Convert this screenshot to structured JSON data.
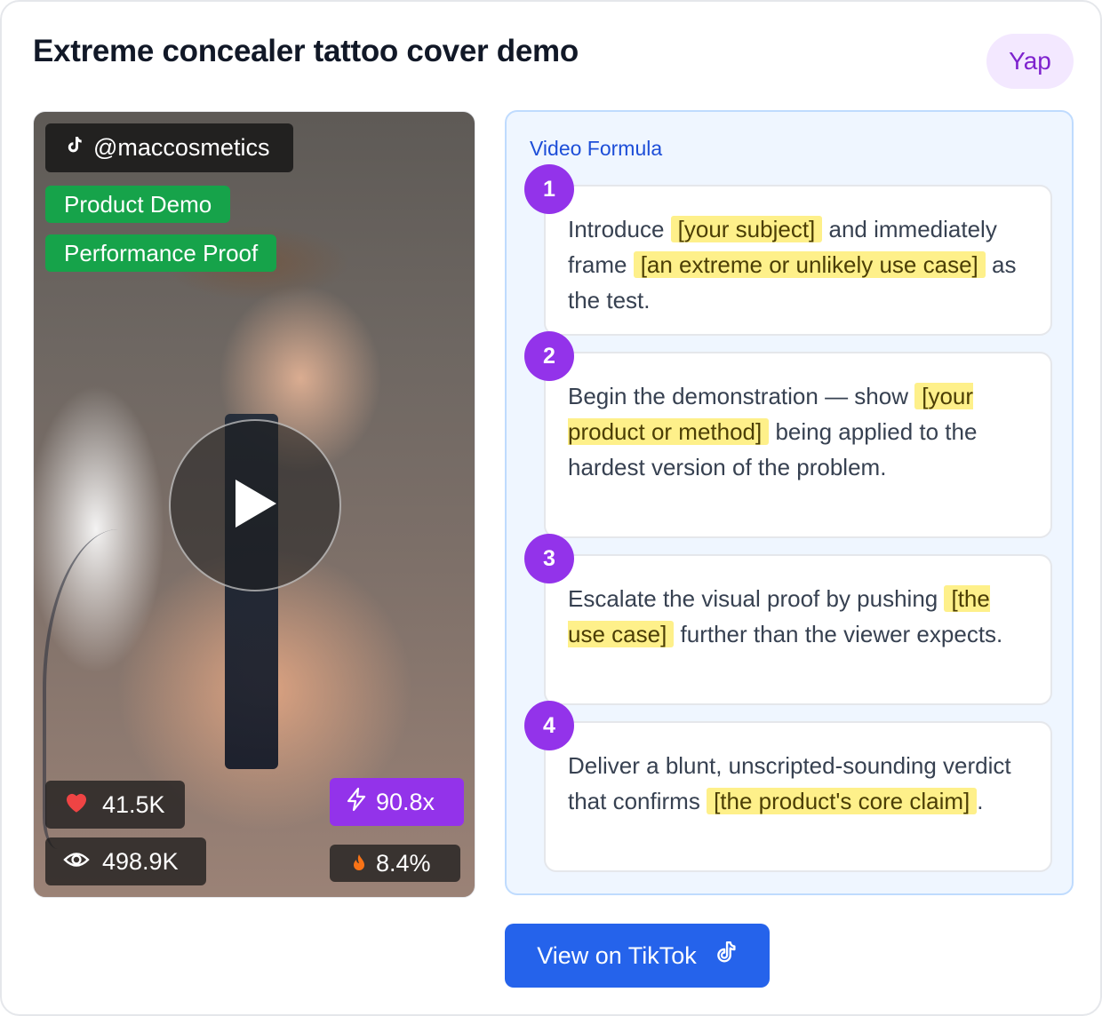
{
  "card": {
    "title": "Extreme concealer tattoo cover demo",
    "category_badge": "Yap"
  },
  "video": {
    "handle": "@maccosmetics",
    "tags": [
      "Product Demo",
      "Performance Proof"
    ],
    "likes": "41.5K",
    "views": "498.9K",
    "multiplier": "90.8x",
    "engagement": "8.4%",
    "icons": [
      "tiktok-icon",
      "play-icon",
      "heart-icon",
      "eye-icon",
      "bolt-icon",
      "flame-icon"
    ]
  },
  "formula": {
    "title": "Video Formula",
    "steps": [
      {
        "number": "1",
        "parts": [
          {
            "text": "Introduce ",
            "hl": false
          },
          {
            "text": "[your subject]",
            "hl": true
          },
          {
            "text": " and immediately frame ",
            "hl": false
          },
          {
            "text": "[an extreme or unlikely use case]",
            "hl": true
          },
          {
            "text": " as the test.",
            "hl": false
          }
        ]
      },
      {
        "number": "2",
        "parts": [
          {
            "text": "Begin the demonstration — show ",
            "hl": false
          },
          {
            "text": "[your product or method]",
            "hl": true
          },
          {
            "text": " being applied to the hardest version of the problem.",
            "hl": false
          }
        ]
      },
      {
        "number": "3",
        "parts": [
          {
            "text": "Escalate the visual proof by pushing ",
            "hl": false
          },
          {
            "text": "[the use case]",
            "hl": true
          },
          {
            "text": " further than the viewer expects.",
            "hl": false
          }
        ]
      },
      {
        "number": "4",
        "parts": [
          {
            "text": "Deliver a blunt, unscripted-sounding verdict that confirms ",
            "hl": false
          },
          {
            "text": "[the product's core claim]",
            "hl": true
          },
          {
            "text": ".",
            "hl": false
          }
        ]
      }
    ]
  },
  "actions": {
    "view_label": "View on TikTok"
  },
  "colors": {
    "accent_purple": "#9333ea",
    "tag_green": "#16a34a",
    "button_blue": "#2563eb",
    "highlight_yellow": "#fef08a",
    "panel_blue": "#eff6ff"
  }
}
